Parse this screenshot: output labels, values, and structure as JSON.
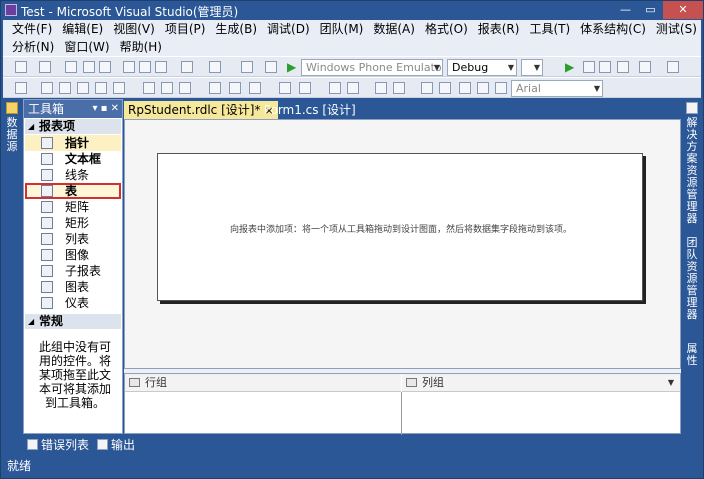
{
  "window": {
    "title": "Test - Microsoft Visual Studio(管理员)",
    "controls": [
      "minimize-icon",
      "maximize-icon",
      "close-icon"
    ]
  },
  "menu": {
    "row1": [
      "文件(F)",
      "编辑(E)",
      "视图(V)",
      "项目(P)",
      "生成(B)",
      "调试(D)",
      "团队(M)",
      "数据(A)",
      "格式(O)",
      "报表(R)",
      "工具(T)",
      "体系结构(C)",
      "测试(S)"
    ],
    "row2": [
      "分析(N)",
      "窗口(W)",
      "帮助(H)"
    ]
  },
  "toolbar": {
    "target_dropdown": "Windows Phone Emulato",
    "config_dropdown": "Debug",
    "font_dropdown": "Arial"
  },
  "side_tabs": {
    "left": "数据源",
    "right_top": "解决方案资源管理器",
    "right_mid": "团队资源管理器",
    "right_bottom": "属性"
  },
  "toolbox": {
    "title": "工具箱",
    "pin_icons": [
      "dropdown-icon",
      "pin-icon",
      "close-icon"
    ],
    "section1": "报表项",
    "items": [
      {
        "label": "指针",
        "icon": "pointer-icon"
      },
      {
        "label": "文本框",
        "icon": "textbox-icon"
      },
      {
        "label": "线条",
        "icon": "line-icon"
      },
      {
        "label": "表",
        "icon": "table-icon"
      },
      {
        "label": "矩阵",
        "icon": "matrix-icon"
      },
      {
        "label": "矩形",
        "icon": "rectangle-icon"
      },
      {
        "label": "列表",
        "icon": "list-icon"
      },
      {
        "label": "图像",
        "icon": "image-icon"
      },
      {
        "label": "子报表",
        "icon": "subreport-icon"
      },
      {
        "label": "图表",
        "icon": "chart-icon"
      },
      {
        "label": "仪表",
        "icon": "gauge-icon"
      }
    ],
    "section2": "常规",
    "empty_note": "此组中没有可用的控件。将某项拖至此文本可将其添加到工具箱。"
  },
  "document": {
    "tabs": [
      {
        "label": "RpStudent.rdlc [设计]*",
        "active": true,
        "close": "×"
      },
      {
        "label": "Form1.cs [设计]",
        "active": false
      }
    ],
    "hint": "向报表中添加项：将一个项从工具箱拖动到设计图面，然后将数据集字段拖动到该项。",
    "row_groups_label": "行组",
    "column_groups_label": "列组"
  },
  "bottom_tabs": [
    "错误列表",
    "输出"
  ],
  "status": "就绪",
  "colors": {
    "frame": "#2b5797",
    "active_tab": "#f6e89a",
    "selected_outline": "#d32f2f"
  }
}
